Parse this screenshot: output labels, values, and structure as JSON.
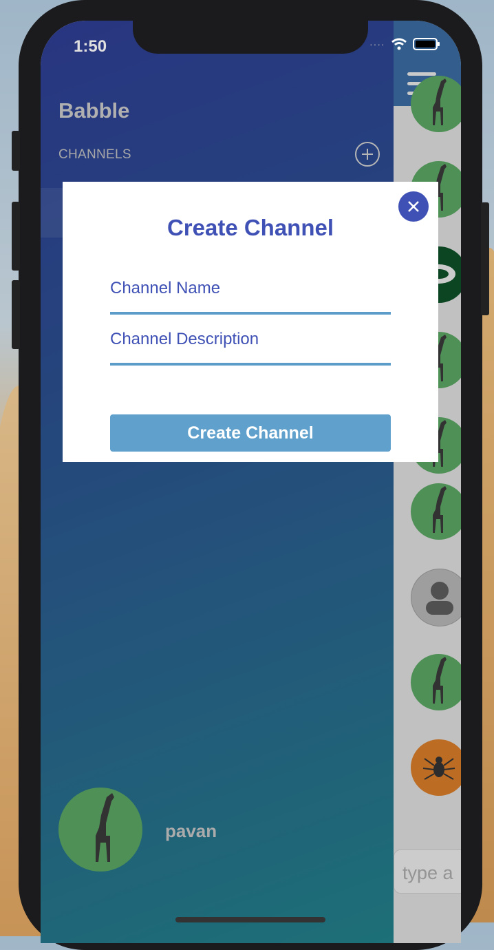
{
  "status": {
    "time": "1:50"
  },
  "drawer": {
    "brand": "Babble",
    "channels_label": "CHANNELS",
    "user": {
      "name": "pavan"
    }
  },
  "chat": {
    "input_placeholder": "type a"
  },
  "modal": {
    "title": "Create Channel",
    "name_placeholder": "Channel Name",
    "description_placeholder": "Channel Description",
    "submit_label": "Create Channel"
  },
  "colors": {
    "accent": "#3f51b5",
    "button": "#5fa1cc",
    "underline": "#5b9cc9",
    "avatar_green": "#5aa463",
    "avatar_orange": "#d77b28"
  },
  "icons": [
    "giraffe-icon",
    "spider-icon",
    "turtle-icon",
    "user-icon",
    "hamburger-icon",
    "plus-icon",
    "close-icon",
    "wifi-icon",
    "battery-icon"
  ]
}
